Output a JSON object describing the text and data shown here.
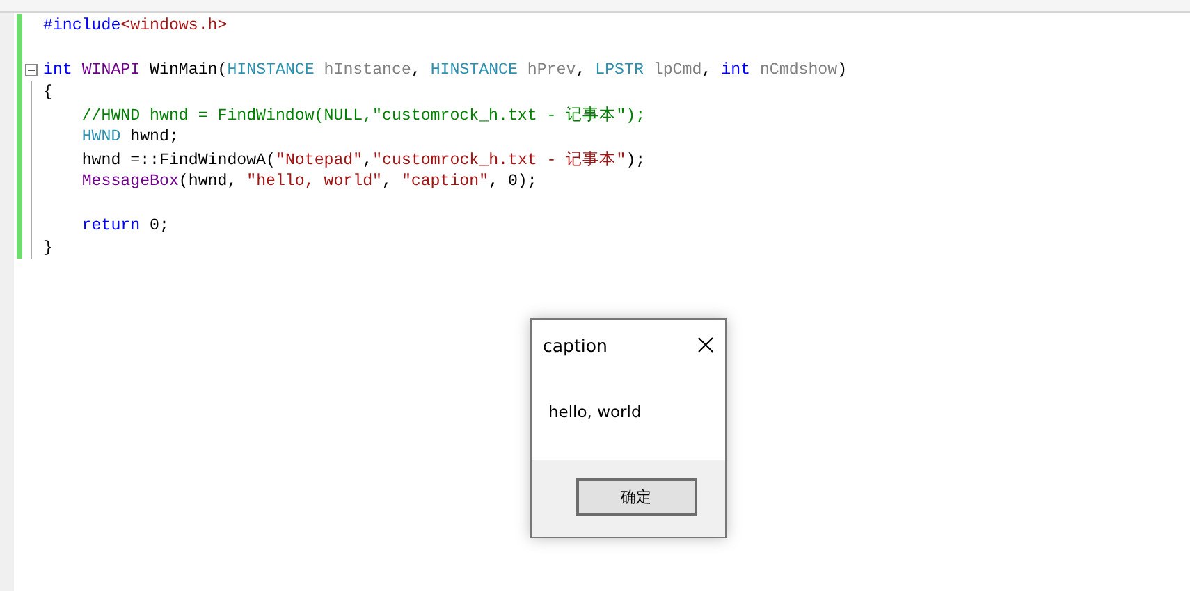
{
  "code_lines": [
    {
      "fold_marker": false,
      "tokens": [
        {
          "kind": "keyword",
          "text": "#include"
        },
        {
          "kind": "string",
          "text": "<windows.h>"
        }
      ]
    },
    {
      "fold_marker": false
    },
    {
      "fold_marker": true,
      "tokens": [
        {
          "kind": "keyword",
          "text": "int "
        },
        {
          "kind": "macro",
          "text": "WINAPI"
        },
        {
          "kind": "plain",
          "text": " WinMain("
        },
        {
          "kind": "type",
          "text": "HINSTANCE"
        },
        {
          "kind": "param",
          "text": " hInstance"
        },
        {
          "kind": "plain",
          "text": ", "
        },
        {
          "kind": "type",
          "text": "HINSTANCE"
        },
        {
          "kind": "param",
          "text": " hPrev"
        },
        {
          "kind": "plain",
          "text": ", "
        },
        {
          "kind": "type",
          "text": "LPSTR"
        },
        {
          "kind": "param",
          "text": " lpCmd"
        },
        {
          "kind": "plain",
          "text": ", "
        },
        {
          "kind": "keyword",
          "text": "int"
        },
        {
          "kind": "param",
          "text": " nCmdshow"
        },
        {
          "kind": "plain",
          "text": ")"
        }
      ]
    },
    {
      "fold_marker": false,
      "tokens": [
        {
          "kind": "plain",
          "text": "{"
        }
      ]
    },
    {
      "fold_marker": false,
      "tokens": [
        {
          "kind": "comment",
          "text": "    //HWND hwnd = FindWindow(NULL,\"customrock_h.txt - 记事本\");"
        }
      ]
    },
    {
      "fold_marker": false,
      "tokens": [
        {
          "kind": "type",
          "text": "    HWND"
        },
        {
          "kind": "plain",
          "text": " hwnd;"
        }
      ]
    },
    {
      "fold_marker": false,
      "tokens": [
        {
          "kind": "plain",
          "text": "    hwnd =::FindWindowA("
        },
        {
          "kind": "string",
          "text": "\"Notepad\""
        },
        {
          "kind": "plain",
          "text": ","
        },
        {
          "kind": "string",
          "text": "\"customrock_h.txt - 记事本\""
        },
        {
          "kind": "plain",
          "text": ");"
        }
      ]
    },
    {
      "fold_marker": false,
      "tokens": [
        {
          "kind": "macro",
          "text": "    MessageBox"
        },
        {
          "kind": "plain",
          "text": "(hwnd, "
        },
        {
          "kind": "string",
          "text": "\"hello, world\""
        },
        {
          "kind": "plain",
          "text": ", "
        },
        {
          "kind": "string",
          "text": "\"caption\""
        },
        {
          "kind": "plain",
          "text": ", 0);"
        }
      ]
    },
    {
      "fold_marker": false
    },
    {
      "fold_marker": false,
      "tokens": [
        {
          "kind": "keyword",
          "text": "    return"
        },
        {
          "kind": "plain",
          "text": " 0;"
        }
      ]
    },
    {
      "fold_marker": false,
      "tokens": [
        {
          "kind": "plain",
          "text": "}"
        }
      ]
    }
  ],
  "message_box": {
    "title": "caption",
    "message": "hello, world",
    "button": "确定"
  }
}
